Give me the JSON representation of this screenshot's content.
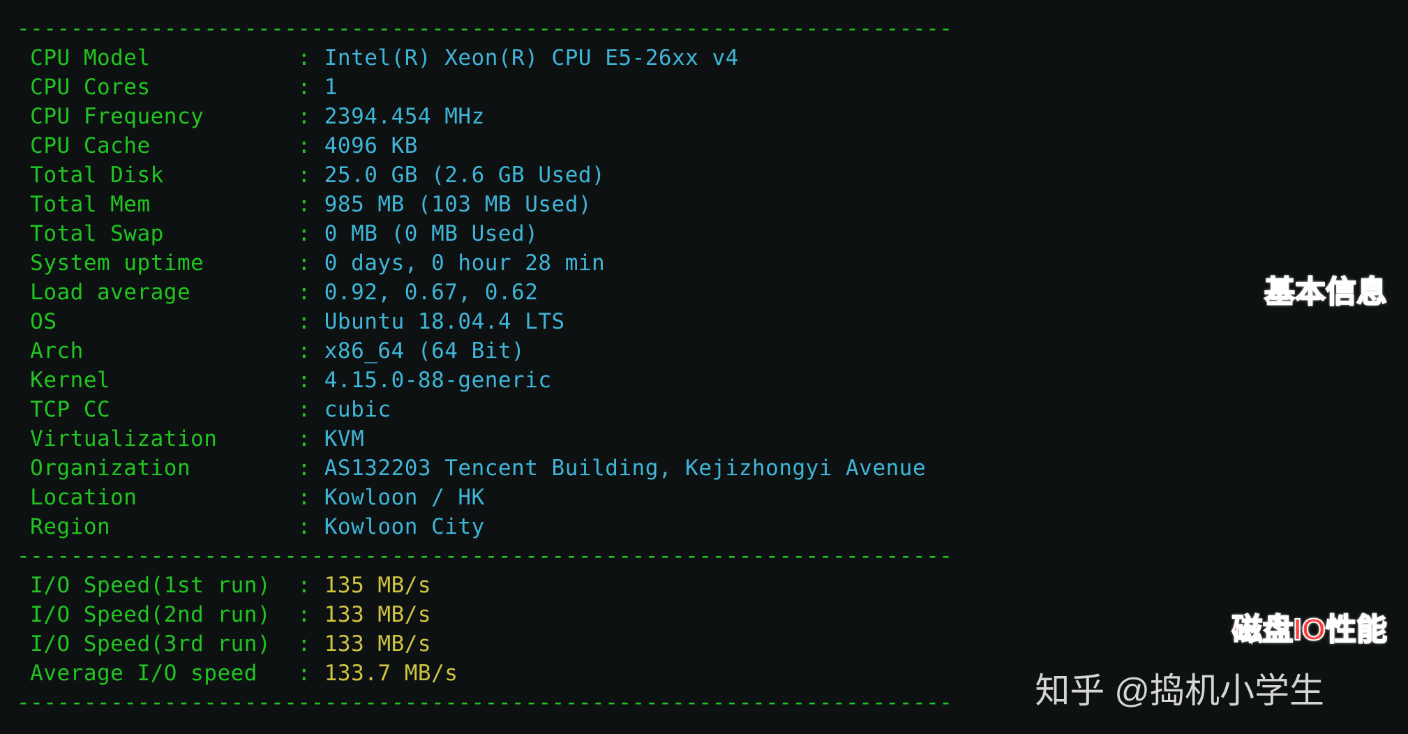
{
  "divider": "----------------------------------------------------------------------",
  "info_rows": [
    {
      "label": "CPU Model",
      "value": "Intel(R) Xeon(R) CPU E5-26xx v4",
      "color": "cyan"
    },
    {
      "label": "CPU Cores",
      "value": "1",
      "color": "cyan"
    },
    {
      "label": "CPU Frequency",
      "value": "2394.454 MHz",
      "color": "cyan"
    },
    {
      "label": "CPU Cache",
      "value": "4096 KB",
      "color": "cyan"
    },
    {
      "label": "Total Disk",
      "value": "25.0 GB (2.6 GB Used)",
      "color": "cyan"
    },
    {
      "label": "Total Mem",
      "value": "985 MB (103 MB Used)",
      "color": "cyan"
    },
    {
      "label": "Total Swap",
      "value": "0 MB (0 MB Used)",
      "color": "cyan"
    },
    {
      "label": "System uptime",
      "value": "0 days, 0 hour 28 min",
      "color": "cyan"
    },
    {
      "label": "Load average",
      "value": "0.92, 0.67, 0.62",
      "color": "cyan"
    },
    {
      "label": "OS",
      "value": "Ubuntu 18.04.4 LTS",
      "color": "cyan"
    },
    {
      "label": "Arch",
      "value": "x86_64 (64 Bit)",
      "color": "cyan"
    },
    {
      "label": "Kernel",
      "value": "4.15.0-88-generic",
      "color": "cyan"
    },
    {
      "label": "TCP CC",
      "value": "cubic",
      "color": "cyan"
    },
    {
      "label": "Virtualization",
      "value": "KVM",
      "color": "cyan"
    },
    {
      "label": "Organization",
      "value": "AS132203 Tencent Building, Kejizhongyi Avenue",
      "color": "cyan"
    },
    {
      "label": "Location",
      "value": "Kowloon / HK",
      "color": "cyan"
    },
    {
      "label": "Region",
      "value": "Kowloon City",
      "color": "cyan"
    }
  ],
  "io_rows": [
    {
      "label": "I/O Speed(1st run)",
      "value": "135 MB/s",
      "color": "yellow"
    },
    {
      "label": "I/O Speed(2nd run)",
      "value": "133 MB/s",
      "color": "yellow"
    },
    {
      "label": "I/O Speed(3rd run)",
      "value": "133 MB/s",
      "color": "yellow"
    },
    {
      "label": "Average I/O speed",
      "value": "133.7 MB/s",
      "color": "yellow"
    }
  ],
  "annotations": {
    "basic_info": "基本信息",
    "disk_io": "磁盘IO性能"
  },
  "watermark": "知乎 @捣机小学生",
  "layout": {
    "label_width": 20,
    "io_label_width": 21
  }
}
